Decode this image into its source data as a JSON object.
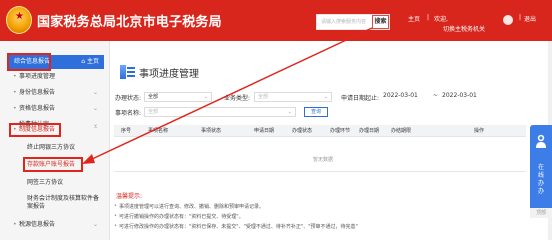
{
  "header": {
    "emblem_text": "中国税务",
    "title": "国家税务总局北京市电子税务局",
    "search_placeholder": "请输入搜索服务内容",
    "search_button": "搜索",
    "home_link": "主页",
    "sep": "|",
    "welcome": "欢迎,",
    "switch_link": "切换主税务机关",
    "logout": "退出",
    "colors": {
      "brand": "#d9261c",
      "accent": "#2f6fdc"
    }
  },
  "sidebar": {
    "head_label": "综合信息报告",
    "home_label": "主页",
    "items": [
      {
        "label": "事项进度管理"
      },
      {
        "label": "身份信息报告"
      },
      {
        "label": "资格信息报告"
      },
      {
        "label": "税费种认定"
      },
      {
        "label": "制度信息报告"
      },
      {
        "label": "税源信息报告"
      }
    ],
    "subs": [
      {
        "label": "终止网银三方协议"
      },
      {
        "label": "存款账户账号报告"
      },
      {
        "label": "网签三方协议"
      },
      {
        "label": "财务会计制度及核算软件备"
      },
      {
        "label": "案报告"
      }
    ]
  },
  "main": {
    "page_title": "事项进度管理",
    "form": {
      "status_label": "办理状态:",
      "status_value": "全部",
      "type_label": "业务类型:",
      "type_value": "全部",
      "date_label": "申请日期起止:",
      "date_from": "2022-03-01",
      "date_dash": "~",
      "date_to": "2022-03-01",
      "name_label": "事项名称:",
      "name_value": "全部",
      "query": "查询"
    },
    "table": {
      "headers": [
        "序号",
        "事项名称",
        "事项状态",
        "申请日期",
        "办理状态",
        "办理环节",
        "办理日期",
        "办结期限",
        "操作"
      ],
      "empty": "暂无数据"
    },
    "tips": {
      "title": "温馨提示:",
      "lines": [
        "事项进度管理可以进行查询、修改、撤销、删除和预审申请记录。",
        "可进行撤销操作的办理状态有：\"资料已提交、待受理\"。",
        "可进行修改操作的办理状态有：\"资料已保存、未提交\"、\"受理不通过、待补齐补正\"、\"预审不通过，待完善\""
      ]
    }
  },
  "float": {
    "text": "在线办办",
    "top": "顶部"
  }
}
